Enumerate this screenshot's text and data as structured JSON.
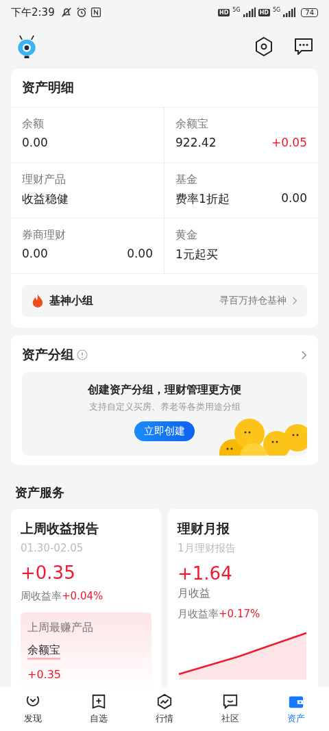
{
  "status_bar": {
    "time": "下午2:39",
    "networks": [
      {
        "badge": "HD",
        "type": "5G"
      },
      {
        "badge": "HD",
        "type": "5G"
      }
    ],
    "battery": "74"
  },
  "asset_details": {
    "title": "资产明细",
    "cells": [
      {
        "label": "余额",
        "value": "0.00"
      },
      {
        "label": "余额宝",
        "value": "922.42",
        "change": "+0.05"
      },
      {
        "label": "理财产品",
        "value": "收益稳健"
      },
      {
        "label": "基金",
        "value": "费率1折起",
        "amount": "0.00"
      },
      {
        "label": "券商理财",
        "value": "0.00",
        "amount": "0.00"
      },
      {
        "label": "黄金",
        "value": "1元起买"
      }
    ],
    "group_banner": {
      "title": "基神小组",
      "link": "寻百万持仓基神"
    }
  },
  "asset_groups": {
    "title": "资产分组",
    "headline": "创建资产分组，理财管理更方便",
    "subtitle": "支持自定义买房、养老等各类用途分组",
    "button": "立即创建"
  },
  "services": {
    "title": "资产服务",
    "cards": [
      {
        "kind": "weekly",
        "title": "上周收益报告",
        "subtitle": "01.30-02.05",
        "amount": "+0.35",
        "rate_label": "周收益率",
        "rate": "+0.04%",
        "top": {
          "label": "上周最赚产品",
          "name": "余额宝",
          "amount": "+0.35"
        }
      },
      {
        "kind": "monthly",
        "title": "理财月报",
        "subtitle": "1月理财报告",
        "amount": "+1.64",
        "amount_label": "月收益",
        "rate_label": "月收益率",
        "rate": "+0.17%"
      }
    ]
  },
  "tab_bar": [
    {
      "label": "发现",
      "selected": false
    },
    {
      "label": "自选",
      "selected": false
    },
    {
      "label": "行情",
      "selected": false
    },
    {
      "label": "社区",
      "selected": false
    },
    {
      "label": "资产",
      "selected": true
    }
  ]
}
